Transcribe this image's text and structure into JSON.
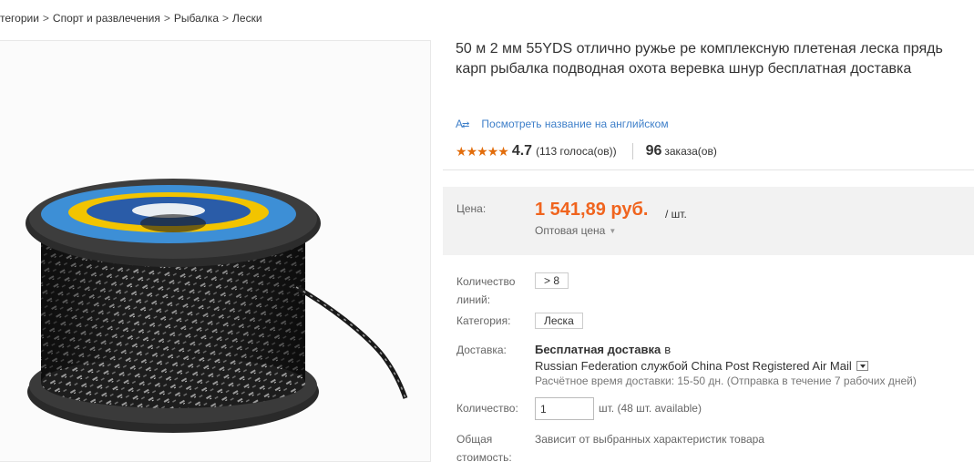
{
  "breadcrumb": {
    "items": [
      "тегории",
      "Спорт и развлечения",
      "Рыбалка",
      "Лески"
    ],
    "separator": ">"
  },
  "product": {
    "title": "50 м 2 мм 55YDS отлично ружье ре комплексную плетеная леска прядь карп рыбалка подводная охота веревка шнур бесплатная доставка",
    "translate_link": "Посмотреть название на английском",
    "translate_icon": "translate-icon",
    "rating": {
      "stars": 5,
      "value": "4.7",
      "votes": "(113 голоса(ов))",
      "orders_count": "96",
      "orders_label": "заказа(ов)"
    }
  },
  "price": {
    "label": "Цена:",
    "value": "1 541,89 руб.",
    "unit": "/ шт.",
    "wholesale": "Оптовая цена"
  },
  "properties": {
    "lines_label_1": "Количество",
    "lines_label_2": "линий:",
    "lines_value": "> 8",
    "category_label": "Категория:",
    "category_value": "Леска"
  },
  "delivery": {
    "label": "Доставка:",
    "free": "Бесплатная доставка",
    "in": "в",
    "route": "Russian Federation службой China Post Registered Air Mail",
    "time": "Расчётное время доставки: 15-50 дн. (Отправка в течение 7 рабочих дней)"
  },
  "quantity": {
    "label": "Количество:",
    "value": "1",
    "info": "шт. (48 шт. available)"
  },
  "total": {
    "label_1": "Общая",
    "label_2": "стоимость:",
    "text": "Зависит от выбранных характеристик товара"
  },
  "colors": {
    "price": "#f0641e",
    "link": "#3e7fc9",
    "star": "#e26d0c",
    "price_bg": "#f2f2f2"
  }
}
